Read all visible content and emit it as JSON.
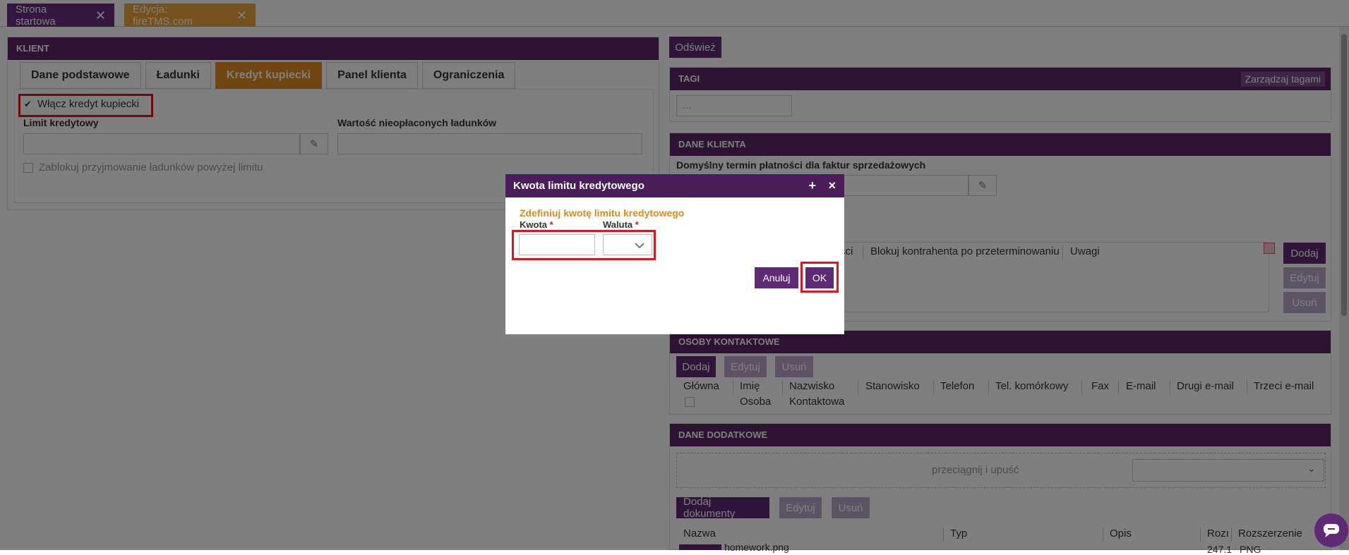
{
  "top_tabs": [
    {
      "label": "Strona startowa",
      "color": "#6a2c7d"
    },
    {
      "label": "Edycja: fireTMS.com",
      "color": "#e8a23a"
    }
  ],
  "client_panel": {
    "title": "KLIENT",
    "tabs": [
      "Dane podstawowe",
      "Ładunki",
      "Kredyt kupiecki",
      "Panel klienta",
      "Ograniczenia"
    ],
    "active_tab": "Kredyt kupiecki",
    "enable_credit_label": "Włącz kredyt kupiecki",
    "credit_limit_label": "Limit kredytowy",
    "unpaid_value_label": "Wartość nieopłaconych ładunków",
    "block_label": "Zablokuj przyjmowanie ładunków powyżej limitu"
  },
  "right": {
    "refresh_label": "Odśwież",
    "tags_title": "TAGI",
    "manage_tags_label": "Zarządzaj tagami",
    "tags_placeholder": "...",
    "client_data_title": "DANE KLIENTA",
    "payment_term_label": "Domyślny termin płatności dla faktur sprzedażowych",
    "grid_headers": [
      "ści",
      "Blokuj kontrahenta po przeterminowaniu",
      "Uwagi"
    ],
    "add_label": "Dodaj",
    "edit_label": "Edytuj",
    "delete_label": "Usuń",
    "contacts_title": "OSOBY KONTAKTOWE",
    "contacts_headers": [
      "Główna",
      "Imię",
      "Nazwisko",
      "Stanowisko",
      "Telefon",
      "Tel. komórkowy",
      "Fax",
      "E-mail",
      "Drugi e-mail",
      "Trzeci e-mail"
    ],
    "contacts_sub": [
      "Osoba",
      "Kontaktowa"
    ],
    "additional_title": "DANE DODATKOWE",
    "drop_label": "przeciągnij i upuść",
    "add_docs_label": "Dodaj dokumenty",
    "docs_headers": [
      "Nazwa",
      "Typ",
      "Opis",
      "Rozı",
      "Rozszerzenie"
    ],
    "doc_row": {
      "name": "homework.png",
      "size": "247.1",
      "ext": "PNG"
    }
  },
  "dialog": {
    "title": "Kwota limitu kredytowego",
    "maximize_icon": "+",
    "close_icon": "×",
    "subtitle": "Zdefiniuj kwotę limitu kredytowego",
    "amount_label": "Kwota",
    "currency_label": "Waluta",
    "required_mark": "*",
    "amount_value": "",
    "currency_value": "",
    "cancel_label": "Anuluj",
    "ok_label": "OK"
  }
}
